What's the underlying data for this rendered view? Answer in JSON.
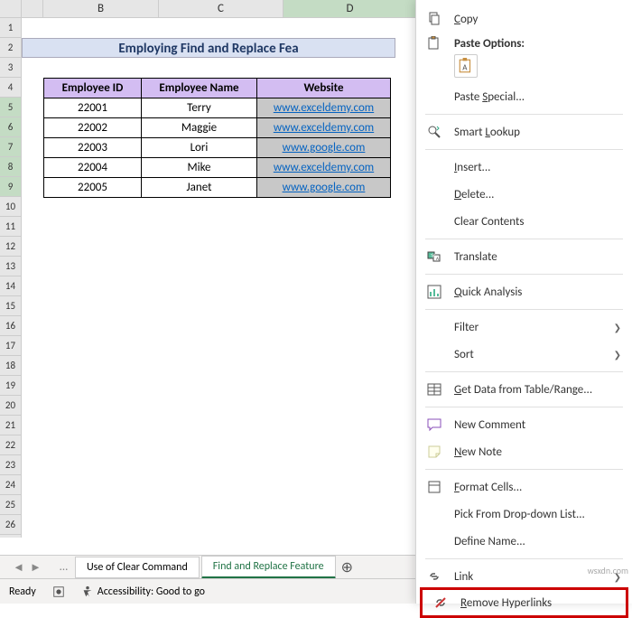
{
  "title": "Employing Find and Replace Fea",
  "columns": [
    "B",
    "C",
    "D"
  ],
  "headers": {
    "emp_id": "Employee ID",
    "emp_name": "Employee Name",
    "website": "Website"
  },
  "rows": [
    {
      "id": "22001",
      "name": "Terry",
      "site": "www.exceldemy.com"
    },
    {
      "id": "22002",
      "name": "Maggie",
      "site": "www.exceldemy.com"
    },
    {
      "id": "22003",
      "name": "Lori",
      "site": "www.google.com"
    },
    {
      "id": "22004",
      "name": "Mike",
      "site": "www.exceldemy.com"
    },
    {
      "id": "22005",
      "name": "Janet",
      "site": "www.google.com"
    }
  ],
  "sheet_tabs": {
    "tab1": "Use of Clear Command",
    "tab2": "Find and Replace Feature"
  },
  "status": {
    "ready": "Ready",
    "acc_label": "Accessibility: Good to go"
  },
  "menu": {
    "copy": "Copy",
    "paste_options": "Paste Options:",
    "paste_special": "Paste Special...",
    "smart_lookup": "Smart Lookup",
    "insert": "Insert...",
    "delete": "Delete...",
    "clear_contents": "Clear Contents",
    "translate": "Translate",
    "quick_analysis": "Quick Analysis",
    "filter": "Filter",
    "sort": "Sort",
    "get_data": "Get Data from Table/Range...",
    "new_comment": "New Comment",
    "new_note": "New Note",
    "format_cells": "Format Cells...",
    "pick_list": "Pick From Drop-down List...",
    "define_name": "Define Name...",
    "link": "Link",
    "remove_hyperlinks": "Remove Hyperlinks"
  },
  "watermark": "wsxdn.com"
}
